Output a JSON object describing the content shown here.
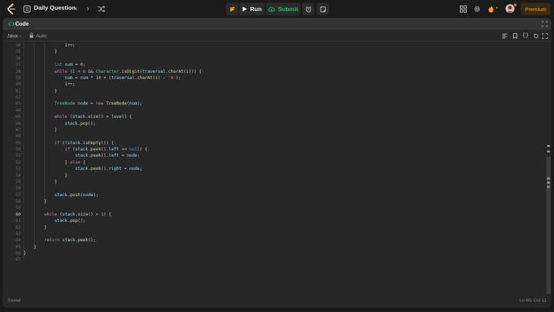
{
  "topbar": {
    "title": "Daily Question",
    "run_label": "Run",
    "submit_label": "Submit",
    "premium_label": "Premium"
  },
  "panel": {
    "title": "Code",
    "language": "Java",
    "mode": "Auto"
  },
  "editor": {
    "line_numbers": [
      "34",
      "35",
      "36",
      "37",
      "38",
      "39",
      "40",
      "41",
      "42",
      "43",
      "44",
      "45",
      "46",
      "47",
      "48",
      "49",
      "50",
      "51",
      "52",
      "53",
      "54",
      "55",
      "56",
      "57",
      "58",
      "59",
      "60",
      "61",
      "62",
      "63",
      "64",
      "65",
      "66",
      "67"
    ],
    "active_line": "60"
  },
  "status": {
    "saved": "Saved",
    "cursor": "Ln 60, Col 11"
  },
  "colors": {
    "accent": "#ffa116",
    "submit": "#2cbb5d",
    "background": "#1a1a1a",
    "panel": "#262626"
  },
  "icons": [
    "logo-icon",
    "problem-list-icon",
    "chevron-left-icon",
    "chevron-right-icon",
    "shuffle-icon",
    "debug-icon",
    "play-icon",
    "cloud-upload-icon",
    "alarm-icon",
    "note-icon",
    "layout-icon",
    "gear-icon",
    "flame-icon",
    "avatar",
    "code-icon",
    "expand-icon",
    "lock-icon",
    "format-icon",
    "bookmark-icon",
    "braces-icon",
    "reset-icon",
    "fullscreen-icon"
  ]
}
